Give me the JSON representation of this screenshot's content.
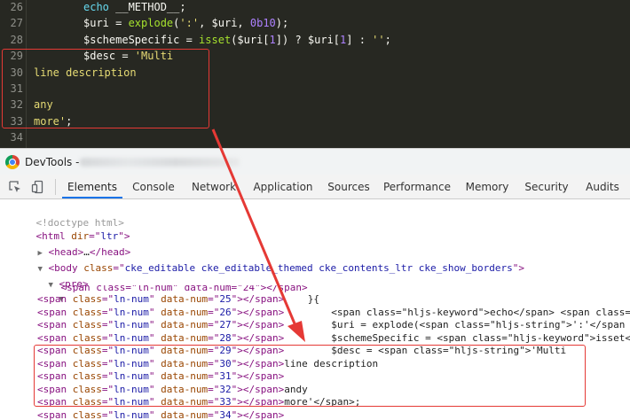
{
  "editor": {
    "lines": [
      {
        "n": "26",
        "tokens": [
          {
            "c": "kw",
            "t": "echo"
          },
          {
            "c": "vr",
            "t": " __METHOD__;"
          }
        ]
      },
      {
        "n": "27",
        "tokens": [
          {
            "c": "vr",
            "t": "$uri = "
          },
          {
            "c": "fn",
            "t": "explode"
          },
          {
            "c": "vr",
            "t": "("
          },
          {
            "c": "str",
            "t": "':'"
          },
          {
            "c": "vr",
            "t": ", $uri, "
          },
          {
            "c": "num",
            "t": "0b10"
          },
          {
            "c": "vr",
            "t": ");"
          }
        ]
      },
      {
        "n": "28",
        "tokens": [
          {
            "c": "vr",
            "t": "$schemeSpecific = "
          },
          {
            "c": "fn",
            "t": "isset"
          },
          {
            "c": "vr",
            "t": "($uri["
          },
          {
            "c": "num",
            "t": "1"
          },
          {
            "c": "vr",
            "t": "]) ? $uri["
          },
          {
            "c": "num",
            "t": "1"
          },
          {
            "c": "vr",
            "t": "] : "
          },
          {
            "c": "str",
            "t": "''"
          },
          {
            "c": "vr",
            "t": ";"
          }
        ]
      },
      {
        "n": "29",
        "tokens": [
          {
            "c": "vr",
            "t": "$desc = "
          },
          {
            "c": "str",
            "t": "'Multi"
          }
        ]
      },
      {
        "n": "30",
        "tokens": [
          {
            "c": "str",
            "t": "line description"
          }
        ]
      },
      {
        "n": "31",
        "tokens": []
      },
      {
        "n": "32",
        "tokens": [
          {
            "c": "str",
            "t": "any"
          }
        ]
      },
      {
        "n": "33",
        "tokens": [
          {
            "c": "str",
            "t": "more'"
          },
          {
            "c": "vr",
            "t": ";"
          }
        ]
      },
      {
        "n": "34",
        "tokens": []
      }
    ]
  },
  "titlebar": {
    "title": "DevTools -"
  },
  "tabs": [
    {
      "id": "elements",
      "label": "Elements",
      "active": true
    },
    {
      "id": "console",
      "label": "Console",
      "active": false
    },
    {
      "id": "network",
      "label": "Network",
      "active": false
    },
    {
      "id": "application",
      "label": "Application",
      "active": false
    },
    {
      "id": "sources",
      "label": "Sources",
      "active": false
    },
    {
      "id": "performance",
      "label": "Performance",
      "active": false
    },
    {
      "id": "memory",
      "label": "Memory",
      "active": false
    },
    {
      "id": "security",
      "label": "Security",
      "active": false
    },
    {
      "id": "audits",
      "label": "Audits",
      "active": false
    }
  ],
  "dom": {
    "doctype": "<!doctype html>",
    "html_open": {
      "tag": "html",
      "attr": "dir",
      "value": "ltr"
    },
    "head": {
      "open": "<head>",
      "ellipsis": "…",
      "close": "</head>"
    },
    "body": {
      "tag": "body",
      "attr": "class",
      "value": "cke_editable cke_editable_themed cke_contents_ltr cke_show_borders"
    },
    "pre": "<pre>",
    "partial_row": "<span class=\"ln-num\" data-num=\"24\"></span>                                                                     ",
    "spans": [
      {
        "num": "25",
        "after": "    }{"
      },
      {
        "num": "26",
        "after": "        <span class=\"hljs-keyword\">echo</span> <span class="
      },
      {
        "num": "27",
        "after": "        $uri = explode(<span class=\"hljs-string\">':'</span"
      },
      {
        "num": "28",
        "after": "        $schemeSpecific = <span class=\"hljs-keyword\">isset</"
      },
      {
        "num": "29",
        "after": "        $desc = <span class=\"hljs-string\">'Multi"
      },
      {
        "num": "30",
        "after": "line description"
      },
      {
        "num": "31",
        "after": ""
      },
      {
        "num": "32",
        "after": "andy"
      },
      {
        "num": "33",
        "after": "more'</span>;"
      },
      {
        "num": "34",
        "after": ""
      }
    ]
  },
  "colors": {
    "highlight": "#e53935",
    "editor_bg": "#272822",
    "active_tab": "#1a73e8"
  },
  "icons": {
    "inspect": "inspect-element-icon",
    "device": "device-toolbar-icon",
    "browser": "chrome-logo-icon"
  }
}
